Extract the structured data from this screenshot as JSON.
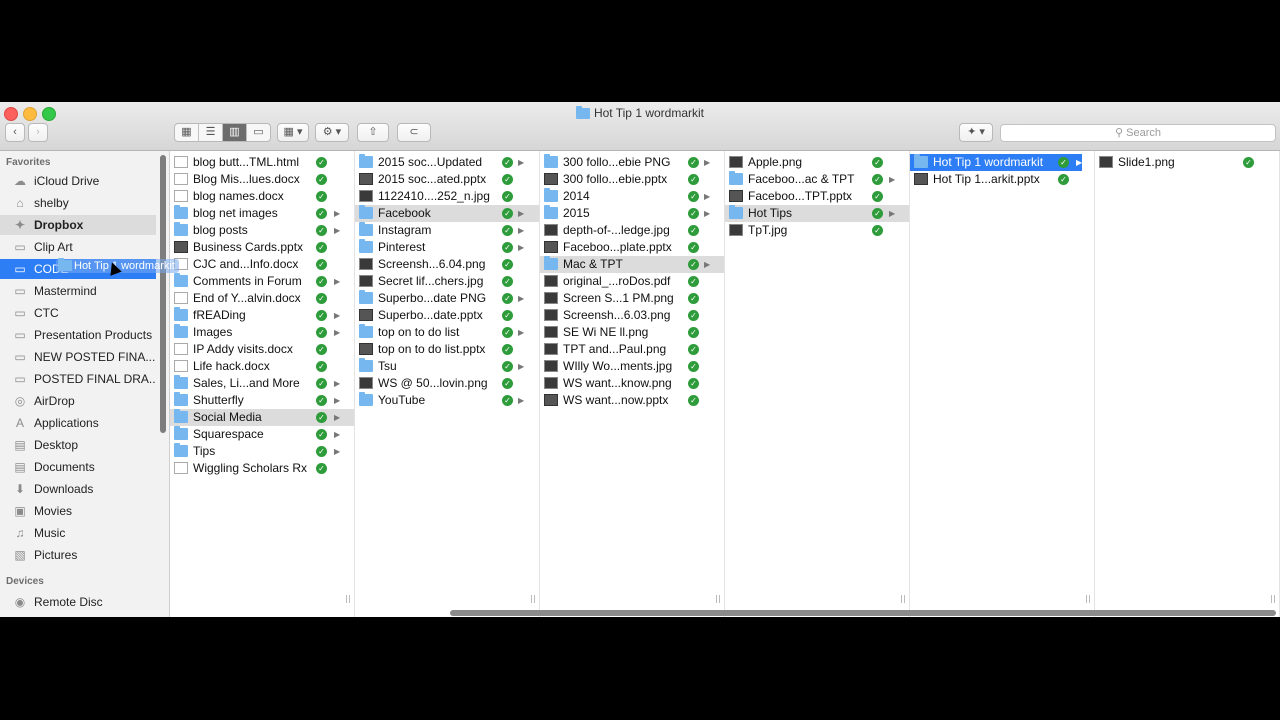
{
  "window": {
    "title": "Hot Tip 1 wordmarkit"
  },
  "toolbar": {
    "search_placeholder": "Search"
  },
  "sidebar": {
    "favorites_header": "Favorites",
    "devices_header": "Devices",
    "items": [
      {
        "label": "iCloud Drive",
        "icon": "cloud-icon"
      },
      {
        "label": "shelby",
        "icon": "home-icon"
      },
      {
        "label": "Dropbox",
        "icon": "dropbox-icon"
      },
      {
        "label": "Clip Art",
        "icon": "folder-icon"
      },
      {
        "label": "CODE",
        "icon": "folder-icon"
      },
      {
        "label": "Mastermind",
        "icon": "folder-icon"
      },
      {
        "label": "CTC",
        "icon": "folder-icon"
      },
      {
        "label": "Presentation Products",
        "icon": "folder-icon"
      },
      {
        "label": "NEW POSTED FINA...",
        "icon": "folder-icon"
      },
      {
        "label": "POSTED FINAL DRA...",
        "icon": "folder-icon"
      },
      {
        "label": "AirDrop",
        "icon": "airdrop-icon"
      },
      {
        "label": "Applications",
        "icon": "applications-icon"
      },
      {
        "label": "Desktop",
        "icon": "desktop-icon"
      },
      {
        "label": "Documents",
        "icon": "documents-icon"
      },
      {
        "label": "Downloads",
        "icon": "downloads-icon"
      },
      {
        "label": "Movies",
        "icon": "movies-icon"
      },
      {
        "label": "Music",
        "icon": "music-icon"
      },
      {
        "label": "Pictures",
        "icon": "pictures-icon"
      }
    ],
    "devices": [
      {
        "label": "Remote Disc",
        "icon": "disc-icon"
      }
    ],
    "drag_label": "Hot Tip 1 wordmarkit"
  },
  "columns": [
    [
      {
        "name": "blog butt...TML.html",
        "kind": "doc"
      },
      {
        "name": "Blog Mis...lues.docx",
        "kind": "doc"
      },
      {
        "name": "blog names.docx",
        "kind": "doc"
      },
      {
        "name": "blog net images",
        "kind": "folder"
      },
      {
        "name": "blog posts",
        "kind": "folder"
      },
      {
        "name": "Business Cards.pptx",
        "kind": "pptx"
      },
      {
        "name": "CJC and...Info.docx",
        "kind": "doc"
      },
      {
        "name": "Comments in Forum",
        "kind": "folder"
      },
      {
        "name": "End of Y...alvin.docx",
        "kind": "doc"
      },
      {
        "name": "fREADing",
        "kind": "folder"
      },
      {
        "name": "Images",
        "kind": "folder"
      },
      {
        "name": "IP Addy visits.docx",
        "kind": "doc"
      },
      {
        "name": "Life hack.docx",
        "kind": "doc"
      },
      {
        "name": "Sales, Li...and More",
        "kind": "folder"
      },
      {
        "name": "Shutterfly",
        "kind": "folder"
      },
      {
        "name": "Social Media",
        "kind": "folder"
      },
      {
        "name": "Squarespace",
        "kind": "folder"
      },
      {
        "name": "Tips",
        "kind": "folder"
      },
      {
        "name": "Wiggling Scholars Rx",
        "kind": "doc"
      }
    ],
    [
      {
        "name": "2015 soc...Updated",
        "kind": "folder"
      },
      {
        "name": "2015 soc...ated.pptx",
        "kind": "pptx"
      },
      {
        "name": "1122410....252_n.jpg",
        "kind": "img"
      },
      {
        "name": "Facebook",
        "kind": "folder"
      },
      {
        "name": "Instagram",
        "kind": "folder"
      },
      {
        "name": "Pinterest",
        "kind": "folder"
      },
      {
        "name": "Screensh...6.04.png",
        "kind": "img"
      },
      {
        "name": "Secret lif...chers.jpg",
        "kind": "img"
      },
      {
        "name": "Superbo...date PNG",
        "kind": "folder"
      },
      {
        "name": "Superbo...date.pptx",
        "kind": "pptx"
      },
      {
        "name": "top on to do list",
        "kind": "folder"
      },
      {
        "name": "top on to do list.pptx",
        "kind": "pptx"
      },
      {
        "name": "Tsu",
        "kind": "folder"
      },
      {
        "name": "WS @ 50...lovin.png",
        "kind": "img"
      },
      {
        "name": "YouTube",
        "kind": "folder"
      }
    ],
    [
      {
        "name": "300 follo...ebie PNG",
        "kind": "folder"
      },
      {
        "name": "300 follo...ebie.pptx",
        "kind": "pptx"
      },
      {
        "name": "2014",
        "kind": "folder"
      },
      {
        "name": "2015",
        "kind": "folder"
      },
      {
        "name": "depth-of-...ledge.jpg",
        "kind": "img"
      },
      {
        "name": "Faceboo...plate.pptx",
        "kind": "pptx"
      },
      {
        "name": "Mac & TPT",
        "kind": "folder"
      },
      {
        "name": "original_...roDos.pdf",
        "kind": "img"
      },
      {
        "name": "Screen S...1 PM.png",
        "kind": "img"
      },
      {
        "name": "Screensh...6.03.png",
        "kind": "img"
      },
      {
        "name": "SE Wi NE ll.png",
        "kind": "img"
      },
      {
        "name": "TPT and...Paul.png",
        "kind": "img"
      },
      {
        "name": "WIlly Wo...ments.jpg",
        "kind": "img"
      },
      {
        "name": "WS want...know.png",
        "kind": "img"
      },
      {
        "name": "WS want...now.pptx",
        "kind": "pptx"
      }
    ],
    [
      {
        "name": "Apple.png",
        "kind": "img"
      },
      {
        "name": "Faceboo...ac & TPT",
        "kind": "folder"
      },
      {
        "name": "Faceboo...TPT.pptx",
        "kind": "pptx"
      },
      {
        "name": "Hot Tips",
        "kind": "folder"
      },
      {
        "name": "TpT.jpg",
        "kind": "img"
      }
    ],
    [
      {
        "name": "Hot Tip 1 wordmarkit",
        "kind": "folder"
      },
      {
        "name": "Hot Tip 1...arkit.pptx",
        "kind": "pptx"
      }
    ],
    [
      {
        "name": "Slide1.png",
        "kind": "img"
      }
    ]
  ]
}
